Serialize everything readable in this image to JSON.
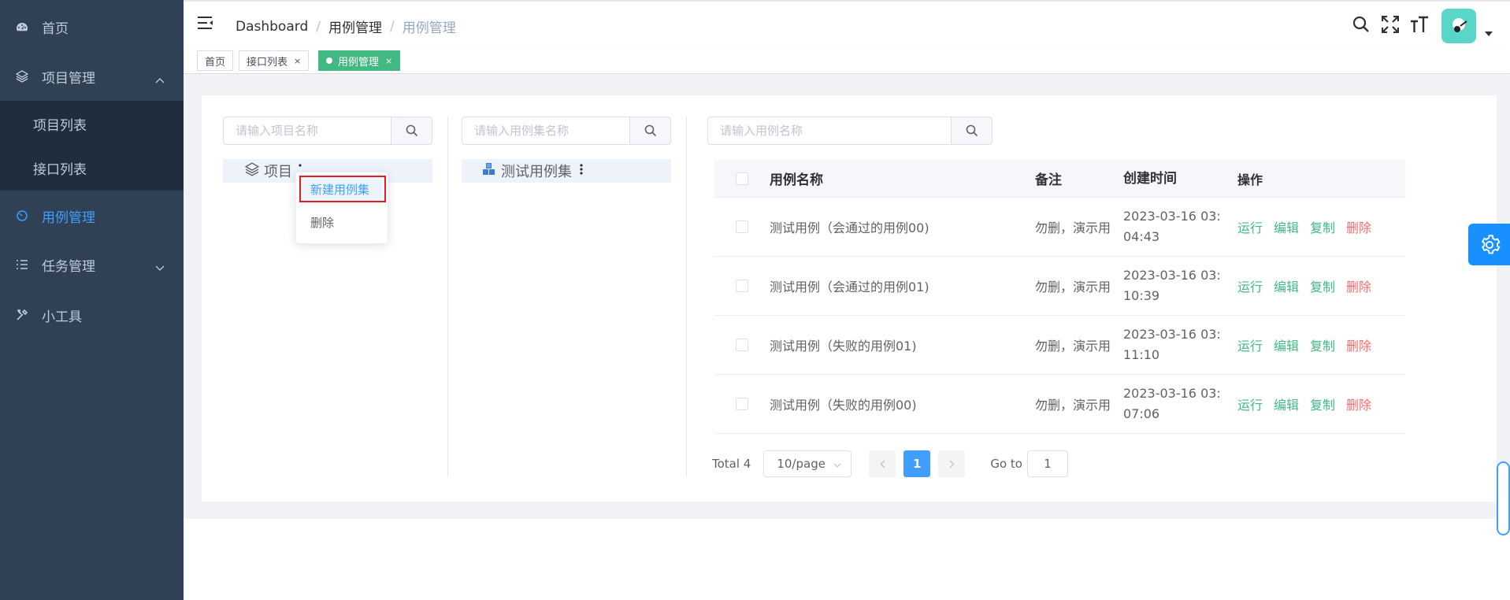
{
  "sidebar": {
    "items": [
      {
        "label": "首页",
        "icon": "dashboard-icon"
      },
      {
        "label": "项目管理",
        "icon": "layers-icon",
        "expanded": true
      },
      {
        "label": "用例管理",
        "icon": "case-icon",
        "active": true
      },
      {
        "label": "任务管理",
        "icon": "task-list-icon",
        "expanded": false
      },
      {
        "label": "小工具",
        "icon": "tools-icon"
      }
    ],
    "subitems": [
      {
        "label": "项目列表"
      },
      {
        "label": "接口列表"
      }
    ]
  },
  "breadcrumb": [
    "Dashboard",
    "用例管理",
    "用例管理"
  ],
  "tags": [
    {
      "label": "首页"
    },
    {
      "label": "接口列表",
      "close": "×"
    },
    {
      "label": "用例管理",
      "close": "×",
      "active": true
    }
  ],
  "panels": {
    "project_search_placeholder": "请输入项目名称",
    "suite_search_placeholder": "请输入用例集名称",
    "case_search_placeholder": "请输入用例名称",
    "project_node": "项目",
    "suite_node": "测试用例集"
  },
  "context_menu": {
    "new_suite": "新建用例集",
    "delete": "删除"
  },
  "table": {
    "headers": {
      "name": "用例名称",
      "remark": "备注",
      "time": "创建时间",
      "ops": "操作"
    },
    "rows": [
      {
        "name": "测试用例（会通过的用例00)",
        "remark": "勿删，演示用",
        "time_1": "2023-03-16 03:",
        "time_2": "04:43"
      },
      {
        "name": "测试用例（会通过的用例01)",
        "remark": "勿删，演示用",
        "time_1": "2023-03-16 03:",
        "time_2": "10:39"
      },
      {
        "name": "测试用例（失败的用例01)",
        "remark": "勿删，演示用",
        "time_1": "2023-03-16 03:",
        "time_2": "11:10"
      },
      {
        "name": "测试用例（失败的用例00)",
        "remark": "勿删，演示用",
        "time_1": "2023-03-16 03:",
        "time_2": "07:06"
      }
    ],
    "ops": {
      "run": "运行",
      "edit": "编辑",
      "copy": "复制",
      "delete": "删除"
    }
  },
  "pagination": {
    "total": "Total 4",
    "page_size": "10/page",
    "current": "1",
    "goto_label": "Go to",
    "goto_value": "1"
  },
  "colors": {
    "sidebar_bg": "#304156",
    "active_menu": "#409eff",
    "tag_active": "#42b983",
    "danger": "#f56c6c"
  }
}
